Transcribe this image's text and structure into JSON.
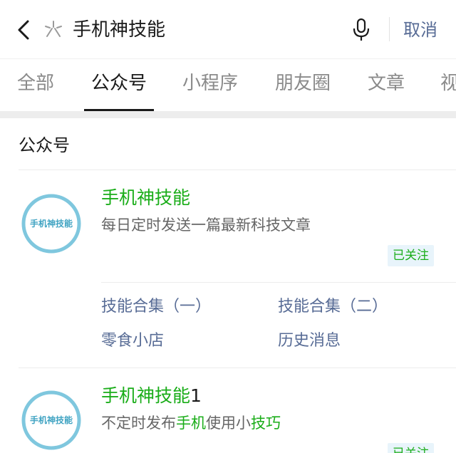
{
  "search": {
    "query": "手机神技能",
    "cancel_label": "取消"
  },
  "tabs": [
    {
      "label": "全部",
      "active": false
    },
    {
      "label": "公众号",
      "active": true
    },
    {
      "label": "小程序",
      "active": false
    },
    {
      "label": "朋友圈",
      "active": false
    },
    {
      "label": "文章",
      "active": false
    },
    {
      "label": "视",
      "active": false
    }
  ],
  "section": {
    "title": "公众号"
  },
  "accounts": [
    {
      "avatar_text": "手机神技能",
      "name": "手机神技能",
      "name_suffix": "",
      "description": "每日定时发送一篇最新科技文章",
      "follow_status": "已关注",
      "menu": [
        "技能合集（一）",
        "技能合集（二）",
        "零食小店",
        "历史消息"
      ]
    },
    {
      "avatar_text": "手机神技能",
      "name": "手机神技能",
      "name_suffix": "1",
      "description_parts": [
        "不定时发布",
        "手机",
        "使用小",
        "技巧"
      ],
      "follow_status": "已关注"
    }
  ],
  "colors": {
    "highlight": "#1aad19",
    "link": "#576b95",
    "badge_bg": "#e8f4fb",
    "ring": "#7fc7de"
  },
  "icons": {
    "back": "chevron-left-icon",
    "search_logo": "sparkle-icon",
    "voice": "microphone-icon"
  }
}
